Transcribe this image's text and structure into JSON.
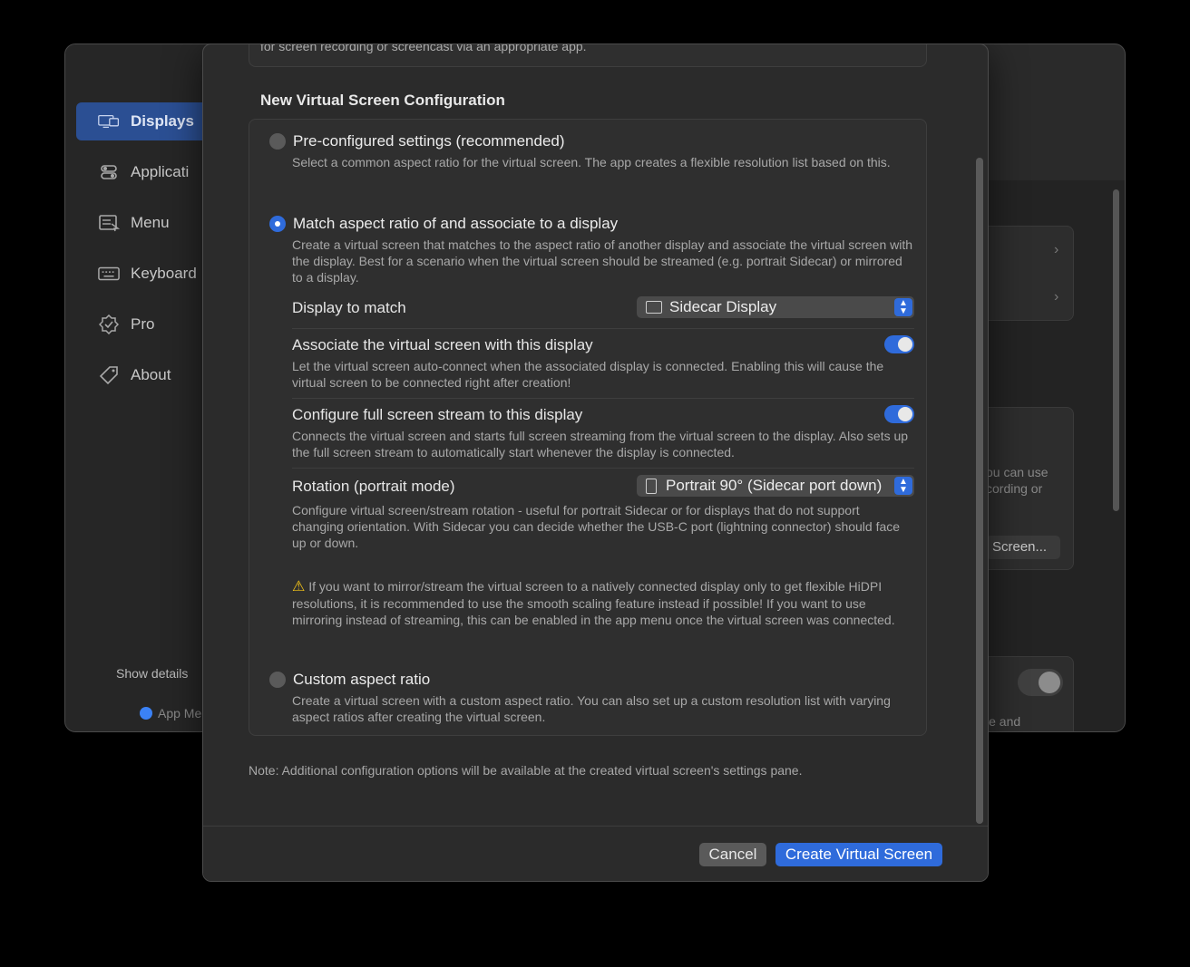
{
  "sidebar": {
    "items": [
      {
        "label": "Displays",
        "icon": "display-icon"
      },
      {
        "label": "Applicati",
        "icon": "toggles-icon"
      },
      {
        "label": "Menu",
        "icon": "menu-icon"
      },
      {
        "label": "Keyboard",
        "icon": "keyboard-icon"
      },
      {
        "label": "Pro",
        "icon": "badge-check-icon"
      },
      {
        "label": "About",
        "icon": "tag-icon"
      }
    ],
    "show_details": "Show details",
    "app_menu": "App Me"
  },
  "background": {
    "snippet1": "ou can use",
    "snippet2": "cording or",
    "screen_button": "Screen...",
    "snippet3": "le and"
  },
  "sheet": {
    "top_text": "for screen recording or screencast via an appropriate app.",
    "section_title": "New Virtual Screen Configuration",
    "options": {
      "preconfigured": {
        "label": "Pre-configured settings (recommended)",
        "desc": "Select a common aspect ratio for the virtual screen. The app creates a flexible resolution list based on this."
      },
      "match": {
        "label": "Match aspect ratio of and associate to a display",
        "desc": "Create a virtual screen that matches to the aspect ratio of another display and associate the virtual screen with the display. Best for a scenario when the virtual screen should be streamed (e.g. portrait Sidecar) or mirrored to a display."
      },
      "custom": {
        "label": "Custom aspect ratio",
        "desc": "Create a virtual screen with a custom aspect ratio. You can also set up a custom resolution list with varying aspect ratios after creating the virtual screen."
      }
    },
    "display_to_match": {
      "label": "Display to match",
      "value": "Sidecar Display"
    },
    "associate": {
      "label": "Associate the virtual screen with this display",
      "desc": "Let the virtual screen auto-connect when the associated display is connected. Enabling this will cause the virtual screen to be connected right after creation!"
    },
    "fullscreen": {
      "label": "Configure full screen stream to this display",
      "desc": "Connects the virtual screen and starts full screen streaming from the virtual screen to the display. Also sets up the full screen stream to automatically start whenever the display is connected."
    },
    "rotation": {
      "label": "Rotation (portrait mode)",
      "value": "Portrait 90° (Sidecar port down)",
      "desc": "Configure virtual screen/stream rotation - useful for portrait Sidecar or for displays that do not support changing orientation. With Sidecar you can decide whether the USB-C port (lightning connector) should face up or down."
    },
    "warning": "If you want to mirror/stream the virtual screen to a natively connected display only to get flexible HiDPI resolutions, it is recommended to use the smooth scaling feature instead if possible! If you want to use mirroring instead of streaming, this can be enabled in the app menu once the virtual screen was connected.",
    "note": "Note: Additional configuration options will be available at the created virtual screen's settings pane.",
    "buttons": {
      "cancel": "Cancel",
      "create": "Create Virtual Screen"
    }
  },
  "colors": {
    "accent": "#2f6bdb",
    "warning": "#f5c518"
  }
}
